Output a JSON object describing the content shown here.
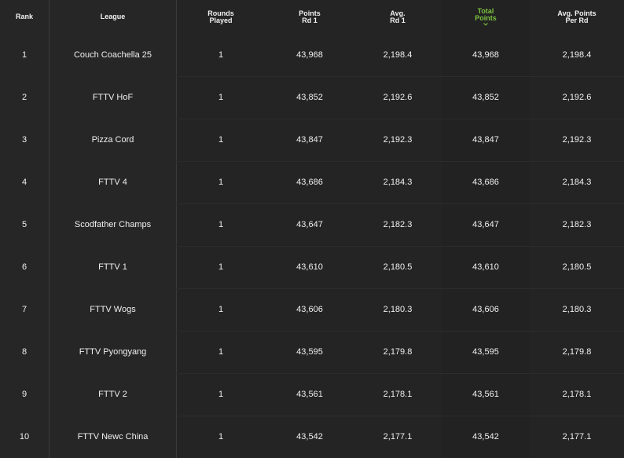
{
  "header": {
    "rank": [
      "Rank"
    ],
    "league": [
      "League"
    ],
    "rounds": [
      "Rounds",
      "Played"
    ],
    "points": [
      "Points",
      "Rd 1"
    ],
    "avg1": [
      "Avg.",
      "Rd 1"
    ],
    "total": [
      "Total",
      "Points"
    ],
    "avgpr": [
      "Avg. Points",
      "Per Rd"
    ]
  },
  "sort": {
    "active_column": "total",
    "direction": "descending",
    "icon": "chevron-down-icon",
    "accent_color": "#7cc23d"
  },
  "rows": [
    {
      "rank": "1",
      "league": "Couch Coachella 25",
      "rounds": "1",
      "points": "43,968",
      "avg1": "2,198.4",
      "total": "43,968",
      "avgpr": "2,198.4"
    },
    {
      "rank": "2",
      "league": "FTTV HoF",
      "rounds": "1",
      "points": "43,852",
      "avg1": "2,192.6",
      "total": "43,852",
      "avgpr": "2,192.6"
    },
    {
      "rank": "3",
      "league": "Pizza Cord",
      "rounds": "1",
      "points": "43,847",
      "avg1": "2,192.3",
      "total": "43,847",
      "avgpr": "2,192.3"
    },
    {
      "rank": "4",
      "league": "FTTV 4",
      "rounds": "1",
      "points": "43,686",
      "avg1": "2,184.3",
      "total": "43,686",
      "avgpr": "2,184.3"
    },
    {
      "rank": "5",
      "league": "Scodfather Champs",
      "rounds": "1",
      "points": "43,647",
      "avg1": "2,182.3",
      "total": "43,647",
      "avgpr": "2,182.3"
    },
    {
      "rank": "6",
      "league": "FTTV 1",
      "rounds": "1",
      "points": "43,610",
      "avg1": "2,180.5",
      "total": "43,610",
      "avgpr": "2,180.5"
    },
    {
      "rank": "7",
      "league": "FTTV Wogs",
      "rounds": "1",
      "points": "43,606",
      "avg1": "2,180.3",
      "total": "43,606",
      "avgpr": "2,180.3"
    },
    {
      "rank": "8",
      "league": "FTTV Pyongyang",
      "rounds": "1",
      "points": "43,595",
      "avg1": "2,179.8",
      "total": "43,595",
      "avgpr": "2,179.8"
    },
    {
      "rank": "9",
      "league": "FTTV 2",
      "rounds": "1",
      "points": "43,561",
      "avg1": "2,178.1",
      "total": "43,561",
      "avgpr": "2,178.1"
    },
    {
      "rank": "10",
      "league": "FTTV Newc China",
      "rounds": "1",
      "points": "43,542",
      "avg1": "2,177.1",
      "total": "43,542",
      "avgpr": "2,177.1"
    }
  ]
}
